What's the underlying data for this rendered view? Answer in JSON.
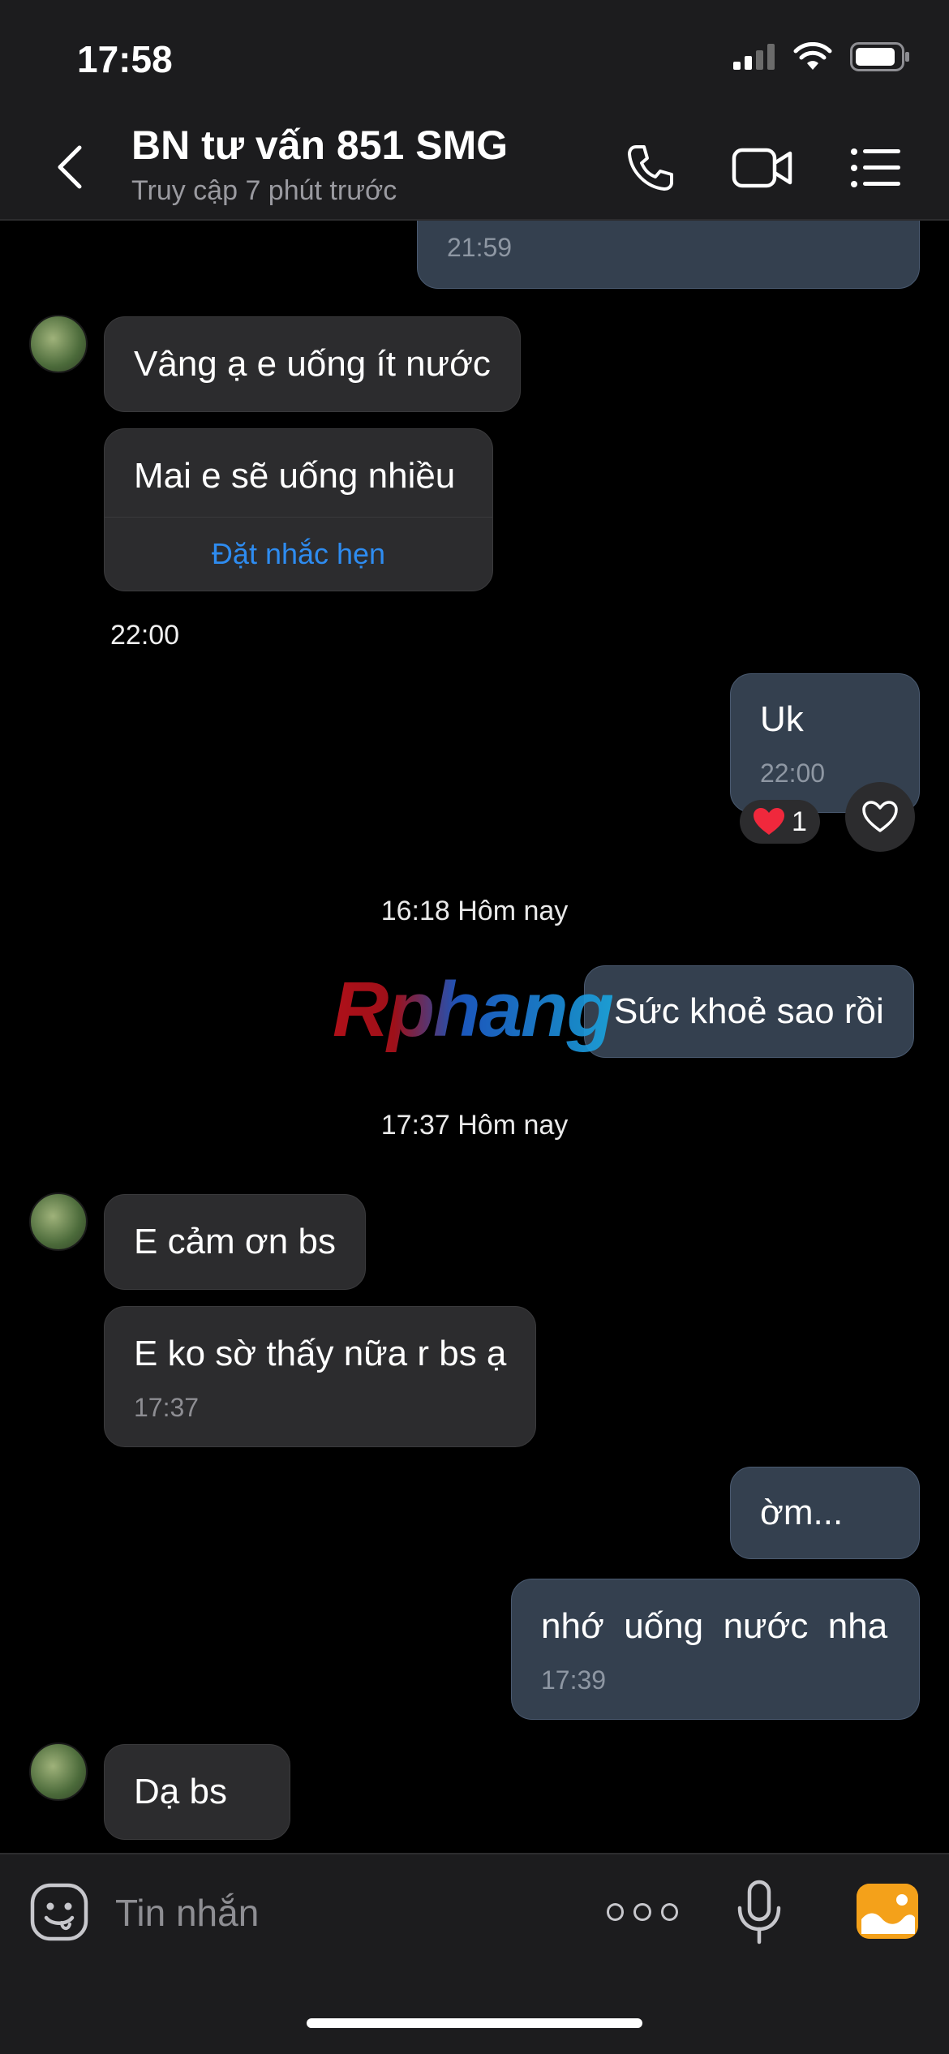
{
  "status_bar": {
    "time": "17:58"
  },
  "header": {
    "title": "BN tư vấn 851 SMG",
    "subtitle": "Truy cập 7 phút trước"
  },
  "chat": {
    "prev_time": "21:59",
    "msg1": "Vâng ạ e uống ít nước",
    "msg2": "Mai e sẽ uống nhiều",
    "msg2_action": "Đặt nhắc hẹn",
    "time_2200": "22:00",
    "msg3": "Uk",
    "msg3_time": "22:00",
    "reaction_count": "1",
    "sep1": "16:18 Hôm nay",
    "msg4": "Sức khoẻ sao rồi",
    "sep2": "17:37 Hôm nay",
    "msg5": "E cảm ơn bs",
    "msg6": "E ko sờ thấy nữa r bs ạ",
    "msg6_time": "17:37",
    "msg7": "ờm...",
    "msg8": "nhớ  uống  nước  nha",
    "msg8_time": "17:39",
    "msg9": "Dạ bs"
  },
  "watermark": "Rphang",
  "composer": {
    "placeholder": "Tin nhắn"
  },
  "colors": {
    "outgoing": "#34404f",
    "incoming": "#2c2c2e",
    "link": "#2e8cf0",
    "photo": "#f4a11a"
  }
}
